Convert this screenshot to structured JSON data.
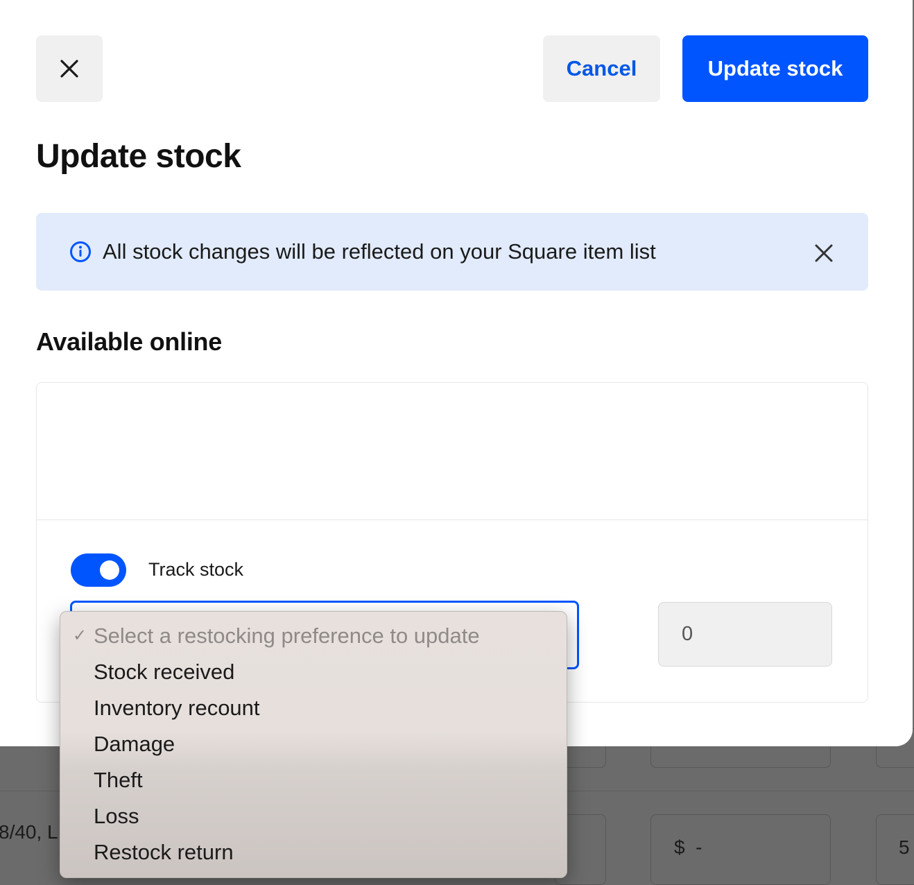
{
  "modal": {
    "close_label": "✕",
    "cancel_label": "Cancel",
    "update_label": "Update stock",
    "title": "Update stock",
    "banner": {
      "text": "All stock changes will be reflected on your Square item list",
      "icon": "info-icon",
      "close_icon": "close-icon"
    },
    "section_heading": "Available online",
    "track_stock": {
      "label": "Track stock",
      "enabled": true
    },
    "quantity": "0"
  },
  "dropdown": {
    "placeholder": "Select a restocking preference to update",
    "check": "✓",
    "options": [
      "Stock received",
      "Inventory recount",
      "Damage",
      "Theft",
      "Loss",
      "Restock return"
    ]
  },
  "background": {
    "row_text": "8/40, L",
    "price_text": "$  -",
    "edge_text": "5"
  },
  "colors": {
    "primary": "#0055ff",
    "banner_bg": "#e1ebfb",
    "backdrop": "#6b6b6b"
  }
}
